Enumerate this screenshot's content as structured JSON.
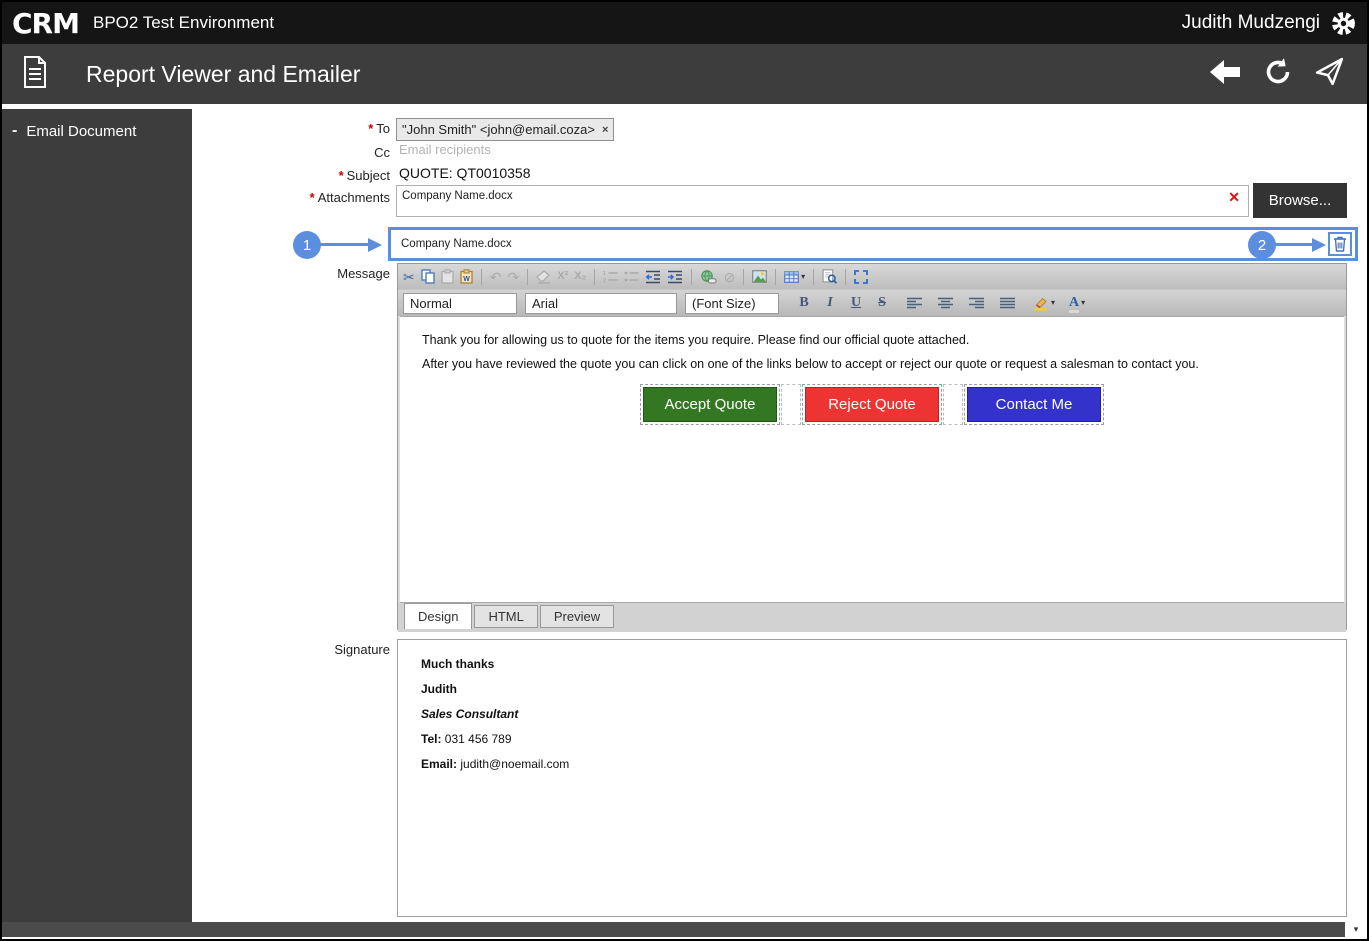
{
  "topbar": {
    "logo_text": "CRM",
    "app_title": "BPO2 Test Environment",
    "user_name": "Judith Mudzengi"
  },
  "header": {
    "title": "Report Viewer and Emailer"
  },
  "sidebar": {
    "items": [
      {
        "collapse_glyph": "-",
        "label": "Email Document"
      }
    ]
  },
  "form": {
    "required_marker": "*",
    "to_label": "To",
    "to_chip": {
      "text": "\"John Smith\" <john@email.coza>",
      "remove_glyph": "×"
    },
    "cc_label": "Cc",
    "cc_placeholder": "Email recipients",
    "subject_label": "Subject",
    "subject_value": "QUOTE: QT0010358",
    "attachments_label": "Attachments",
    "attachments_value": "Company Name.docx",
    "attachments_clear_glyph": "✕",
    "browse_label": "Browse...",
    "message_label": "Message",
    "signature_label": "Signature"
  },
  "callouts": {
    "step1": "1",
    "step2": "2"
  },
  "attachment_row": {
    "filename": "Company Name.docx"
  },
  "editor": {
    "toolbar_glyphs": {
      "cut": "✂",
      "undo": "↶",
      "redo": "↷",
      "superscript": "X²",
      "subscript": "X₂",
      "unlink": "⊘",
      "caret": "▾",
      "fontcolor_letter": "A"
    },
    "format": {
      "style": "Normal",
      "font": "Arial",
      "size": "(Font Size)",
      "bold": "B",
      "italic": "I",
      "underline": "U",
      "strike": "S"
    },
    "body": {
      "para1": "Thank you for allowing us to quote for the items you require. Please find our official quote attached.",
      "para2": "After you have reviewed the quote you can click on one of the links below to accept or reject our quote or request a salesman to contact you.",
      "buttons": [
        {
          "label": "Accept Quote",
          "color": "#337722"
        },
        {
          "label": "Reject Quote",
          "color": "#ee3333"
        },
        {
          "label": "Contact Me",
          "color": "#3333cc"
        }
      ]
    },
    "tabs": [
      {
        "label": "Design"
      },
      {
        "label": "HTML"
      },
      {
        "label": "Preview"
      }
    ]
  },
  "signature": {
    "line1": "Much thanks",
    "line2": "Judith",
    "line3": "Sales Consultant",
    "tel_label": "Tel:",
    "tel_value": " 031 456 789",
    "email_label": "Email:",
    "email_value": " judith@noemail.com"
  },
  "scrollbar": {
    "arrow_glyph": "▾"
  },
  "colors": {
    "callout_blue": "#5c8ee0",
    "accent_dark": "#3d3d3d",
    "accept_green": "#337722",
    "reject_red": "#ee3333",
    "contact_blue": "#3333cc"
  }
}
